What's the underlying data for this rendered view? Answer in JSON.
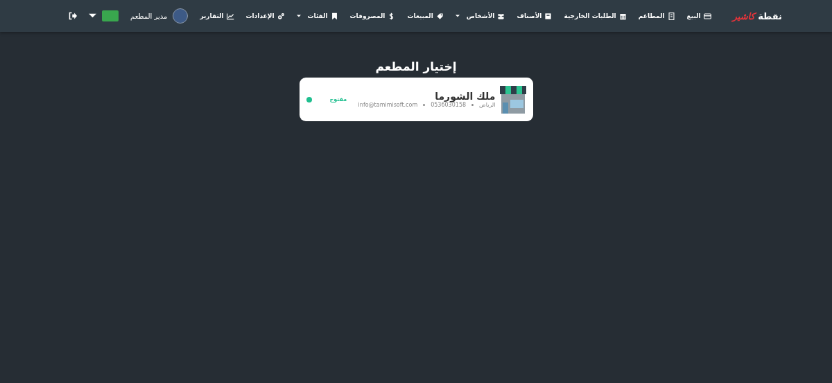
{
  "logo": {
    "word_1": "نقطة",
    "word_2": "كاشير"
  },
  "nav_items": [
    {
      "label": "البيع",
      "dropdown": false
    },
    {
      "label": "المطاعم",
      "dropdown": false
    },
    {
      "label": "الطلبات الخارجية",
      "dropdown": false
    },
    {
      "label": "الأصناف",
      "dropdown": false
    },
    {
      "label": "الأشخاص",
      "dropdown": true
    },
    {
      "label": "المبيعات",
      "dropdown": false
    },
    {
      "label": "المصروفات",
      "dropdown": false
    },
    {
      "label": "الفئات",
      "dropdown": true
    },
    {
      "label": "الإعدادات",
      "dropdown": false
    },
    {
      "label": "التقارير",
      "dropdown": false
    }
  ],
  "user": {
    "name": "مدير المطعم"
  },
  "page_title": "إختيار المطعم",
  "restaurants": [
    {
      "name": "ملك الشورما",
      "city": "الرياض",
      "phone": "0536030158",
      "email": "info@tamimisoft.com",
      "status": "مفتوح",
      "color": "#1fbf8f"
    }
  ]
}
